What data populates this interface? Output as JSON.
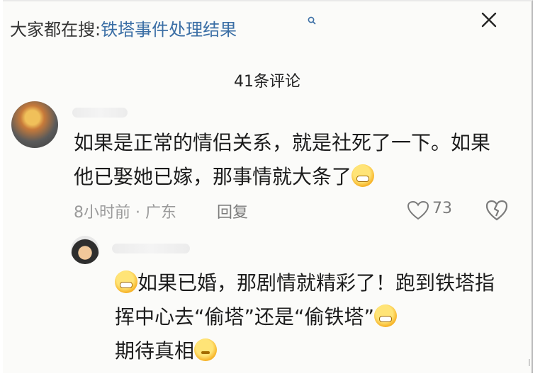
{
  "search_bar": {
    "prefix": "大家都在搜",
    "separator": ":",
    "query": "铁塔事件处理结果"
  },
  "comments_header": {
    "count_label": "41条评论"
  },
  "comments": [
    {
      "text": "如果是正常的情侣关系，就是社死了一下。如果他已娶她已嫁，那事情就大条了",
      "time": "8小时前",
      "location": "广东",
      "meta_separator": "·",
      "reply_label": "回复",
      "likes": "73"
    }
  ],
  "replies": [
    {
      "text_part1": "如果已婚，那剧情就精彩了！跑到铁塔指挥中心去“偷塔”还是“偷铁塔”",
      "text_part2": "期待真相"
    }
  ],
  "icons": {
    "search": "search-icon",
    "close": "close-icon",
    "like": "heart-icon",
    "dislike": "broken-heart-icon",
    "emoji_grin": "grinning-sweat-emoji",
    "emoji_think": "thinking-emoji"
  },
  "colors": {
    "link": "#3a6ea5",
    "text": "#1c1c1c",
    "muted": "#9a9a9a"
  }
}
